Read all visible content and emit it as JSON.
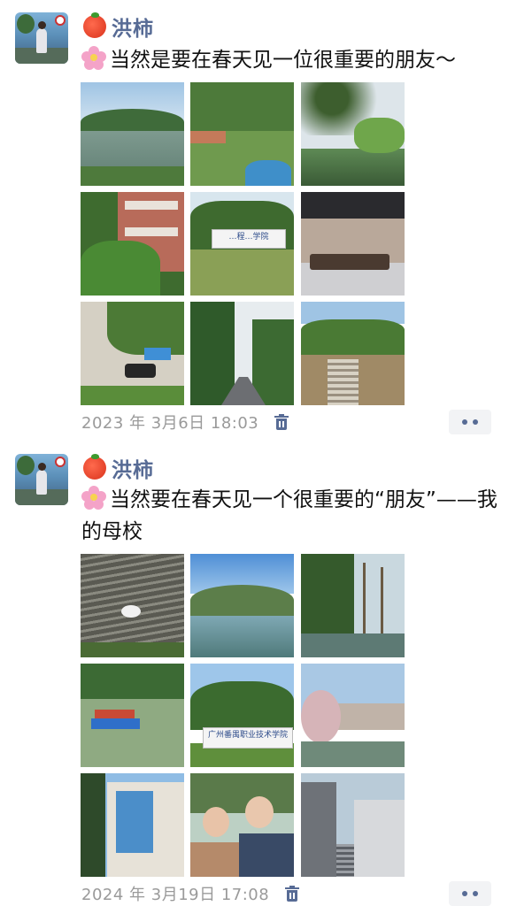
{
  "posts": [
    {
      "name": "洪柿",
      "name_emoji": "tomato-emoji",
      "caption_emoji": "cherry-blossom-emoji",
      "caption": "当然是要在春天见一位很重要的朋友～",
      "timestamp": "2023 年 3月6日 18:03",
      "photos": [
        "lake-between-green-hills",
        "campus-lawn-trees-blue-planter",
        "tree-branches-over-lake",
        "red-brick-building-with-greenery",
        "college-sign-polytechnic",
        "modern-cafe-interior",
        "street-with-shops-and-car",
        "tree-lined-road",
        "stone-stairs-on-hillside"
      ],
      "sign_text": "…程…学院"
    },
    {
      "name": "洪柿",
      "name_emoji": "tomato-emoji",
      "caption_emoji": "cherry-blossom-emoji",
      "caption": "当然要在春天见一个很重要的“朋友”——我的母校",
      "timestamp": "2024 年 3月19日 17:08",
      "photos": [
        "swan-on-rippled-water",
        "lake-with-mountains",
        "thin-trees-by-lake",
        "dragon-boat-on-lake",
        "school-name-sign-stone",
        "lake-with-blossoms-and-buildings",
        "blue-glass-building",
        "couple-selfie",
        "grey-building-with-stairs"
      ],
      "sign_text": "广州番禺职业技术学院"
    }
  ],
  "colors": {
    "name": "#576b95",
    "time": "#9a9a9a",
    "text": "#111111",
    "more_bg": "#f2f3f5"
  }
}
